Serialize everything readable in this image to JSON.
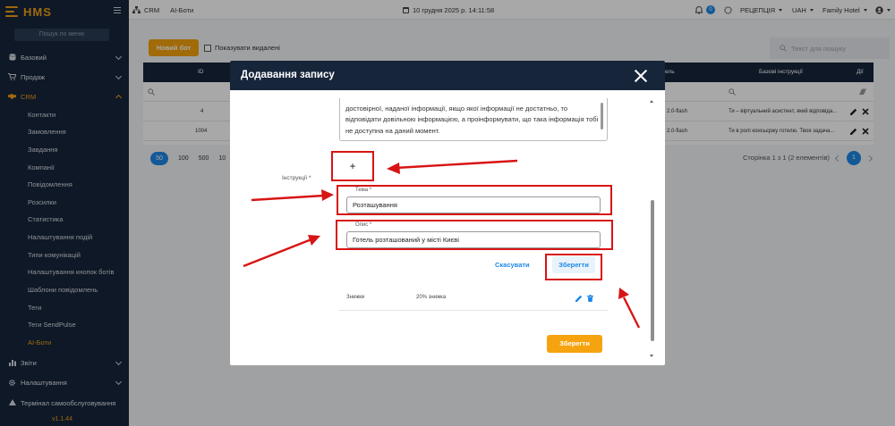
{
  "app": {
    "logo": "HMS",
    "version": "v1.1.44"
  },
  "sidebar": {
    "search_placeholder": "Пошук по меню",
    "sections": [
      {
        "label": "Базовий",
        "icon": "database-icon"
      },
      {
        "label": "Продаж",
        "icon": "cart-icon"
      },
      {
        "label": "CRM",
        "icon": "handshake-icon"
      },
      {
        "label": "Звіти",
        "icon": "chart-icon"
      },
      {
        "label": "Налаштування",
        "icon": "gear-icon"
      },
      {
        "label": "Термінал самообслуговування",
        "icon": "terminal-icon"
      }
    ],
    "crm_items": [
      "Контакти",
      "Замовлення",
      "Завдання",
      "Компанії",
      "Повідомлення",
      "Розсилки",
      "Статистика",
      "Налаштування подій",
      "Типи комунікацій",
      "Налаштування кнопок ботів",
      "Шаблони повідомлень",
      "Теги",
      "Теги SendPulse",
      "AI-Боти"
    ],
    "active_item": "AI-Боти"
  },
  "topbar": {
    "breadcrumb_section": "CRM",
    "breadcrumb_page": "AI-Боти",
    "datetime": "10 грудня 2025 р. 14:11:58",
    "notifications_count": "0",
    "role": "РЕЦЕПЦІЯ",
    "currency": "UAH",
    "hotel": "Family Hotel"
  },
  "page": {
    "new_bot_button": "Новий бот",
    "show_deleted_label": "Показувати видалені",
    "search_placeholder": "Текст для пошуку",
    "columns": {
      "id": "ID",
      "model": "ель",
      "base_instructions": "Базові інструкції",
      "actions": "Дії"
    },
    "rows": [
      {
        "id": "4",
        "model": "2.0-flash",
        "instructions": "Ти – віртуальний асистент, який відповіда..."
      },
      {
        "id": "1004",
        "model": "2.0-flash",
        "instructions": "Ти в ролі консьєржу готелю. Твоя задача..."
      }
    ],
    "page_sizes": [
      "50",
      "100",
      "500",
      "10"
    ],
    "page_info": "Сторінка 1 з 1 (2 елементів)",
    "current_page": "1"
  },
  "modal": {
    "title": "Додавання запису",
    "textarea_lines": [
      "достовірної, наданої інформації, якщо якої інформації не достатньо, то",
      "відповідати довільною інформацією, а проінформувати, що така інформація тобі",
      "не доступна на даний момент."
    ],
    "add_button": "+",
    "instructions_label": "Інструкції *",
    "topic_label": "Тема *",
    "topic_value": "Розташування",
    "description_label": "Опис *",
    "description_value": "Готель розташований у місті Києві",
    "cancel_button": "Скасувати",
    "save_inline_button": "Зберегти",
    "existing_row": {
      "topic": "Знижки",
      "description": "20% знижка"
    },
    "save_button": "Зберегти"
  },
  "colors": {
    "accent": "#f5a30f",
    "navy": "#17253b",
    "link": "#1e88e5",
    "annotation": "#d81414"
  }
}
